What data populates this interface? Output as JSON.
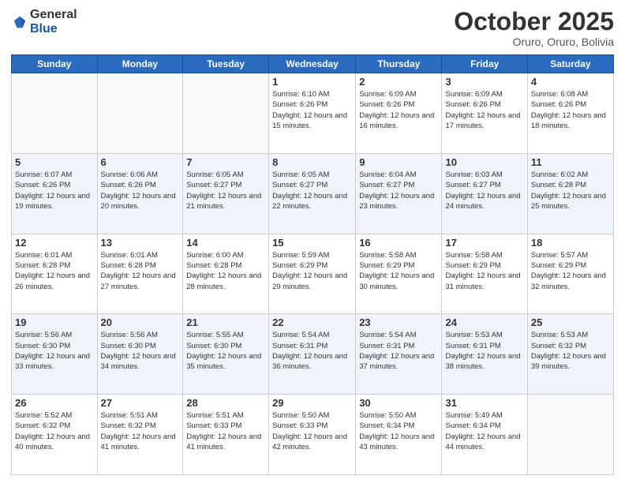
{
  "logo": {
    "general": "General",
    "blue": "Blue"
  },
  "header": {
    "month": "October 2025",
    "location": "Oruro, Oruro, Bolivia"
  },
  "weekdays": [
    "Sunday",
    "Monday",
    "Tuesday",
    "Wednesday",
    "Thursday",
    "Friday",
    "Saturday"
  ],
  "weeks": [
    [
      {
        "day": "",
        "sunrise": "",
        "sunset": "",
        "daylight": ""
      },
      {
        "day": "",
        "sunrise": "",
        "sunset": "",
        "daylight": ""
      },
      {
        "day": "",
        "sunrise": "",
        "sunset": "",
        "daylight": ""
      },
      {
        "day": "1",
        "sunrise": "Sunrise: 6:10 AM",
        "sunset": "Sunset: 6:26 PM",
        "daylight": "Daylight: 12 hours and 15 minutes."
      },
      {
        "day": "2",
        "sunrise": "Sunrise: 6:09 AM",
        "sunset": "Sunset: 6:26 PM",
        "daylight": "Daylight: 12 hours and 16 minutes."
      },
      {
        "day": "3",
        "sunrise": "Sunrise: 6:09 AM",
        "sunset": "Sunset: 6:26 PM",
        "daylight": "Daylight: 12 hours and 17 minutes."
      },
      {
        "day": "4",
        "sunrise": "Sunrise: 6:08 AM",
        "sunset": "Sunset: 6:26 PM",
        "daylight": "Daylight: 12 hours and 18 minutes."
      }
    ],
    [
      {
        "day": "5",
        "sunrise": "Sunrise: 6:07 AM",
        "sunset": "Sunset: 6:26 PM",
        "daylight": "Daylight: 12 hours and 19 minutes."
      },
      {
        "day": "6",
        "sunrise": "Sunrise: 6:06 AM",
        "sunset": "Sunset: 6:26 PM",
        "daylight": "Daylight: 12 hours and 20 minutes."
      },
      {
        "day": "7",
        "sunrise": "Sunrise: 6:05 AM",
        "sunset": "Sunset: 6:27 PM",
        "daylight": "Daylight: 12 hours and 21 minutes."
      },
      {
        "day": "8",
        "sunrise": "Sunrise: 6:05 AM",
        "sunset": "Sunset: 6:27 PM",
        "daylight": "Daylight: 12 hours and 22 minutes."
      },
      {
        "day": "9",
        "sunrise": "Sunrise: 6:04 AM",
        "sunset": "Sunset: 6:27 PM",
        "daylight": "Daylight: 12 hours and 23 minutes."
      },
      {
        "day": "10",
        "sunrise": "Sunrise: 6:03 AM",
        "sunset": "Sunset: 6:27 PM",
        "daylight": "Daylight: 12 hours and 24 minutes."
      },
      {
        "day": "11",
        "sunrise": "Sunrise: 6:02 AM",
        "sunset": "Sunset: 6:28 PM",
        "daylight": "Daylight: 12 hours and 25 minutes."
      }
    ],
    [
      {
        "day": "12",
        "sunrise": "Sunrise: 6:01 AM",
        "sunset": "Sunset: 6:28 PM",
        "daylight": "Daylight: 12 hours and 26 minutes."
      },
      {
        "day": "13",
        "sunrise": "Sunrise: 6:01 AM",
        "sunset": "Sunset: 6:28 PM",
        "daylight": "Daylight: 12 hours and 27 minutes."
      },
      {
        "day": "14",
        "sunrise": "Sunrise: 6:00 AM",
        "sunset": "Sunset: 6:28 PM",
        "daylight": "Daylight: 12 hours and 28 minutes."
      },
      {
        "day": "15",
        "sunrise": "Sunrise: 5:59 AM",
        "sunset": "Sunset: 6:29 PM",
        "daylight": "Daylight: 12 hours and 29 minutes."
      },
      {
        "day": "16",
        "sunrise": "Sunrise: 5:58 AM",
        "sunset": "Sunset: 6:29 PM",
        "daylight": "Daylight: 12 hours and 30 minutes."
      },
      {
        "day": "17",
        "sunrise": "Sunrise: 5:58 AM",
        "sunset": "Sunset: 6:29 PM",
        "daylight": "Daylight: 12 hours and 31 minutes."
      },
      {
        "day": "18",
        "sunrise": "Sunrise: 5:57 AM",
        "sunset": "Sunset: 6:29 PM",
        "daylight": "Daylight: 12 hours and 32 minutes."
      }
    ],
    [
      {
        "day": "19",
        "sunrise": "Sunrise: 5:56 AM",
        "sunset": "Sunset: 6:30 PM",
        "daylight": "Daylight: 12 hours and 33 minutes."
      },
      {
        "day": "20",
        "sunrise": "Sunrise: 5:56 AM",
        "sunset": "Sunset: 6:30 PM",
        "daylight": "Daylight: 12 hours and 34 minutes."
      },
      {
        "day": "21",
        "sunrise": "Sunrise: 5:55 AM",
        "sunset": "Sunset: 6:30 PM",
        "daylight": "Daylight: 12 hours and 35 minutes."
      },
      {
        "day": "22",
        "sunrise": "Sunrise: 5:54 AM",
        "sunset": "Sunset: 6:31 PM",
        "daylight": "Daylight: 12 hours and 36 minutes."
      },
      {
        "day": "23",
        "sunrise": "Sunrise: 5:54 AM",
        "sunset": "Sunset: 6:31 PM",
        "daylight": "Daylight: 12 hours and 37 minutes."
      },
      {
        "day": "24",
        "sunrise": "Sunrise: 5:53 AM",
        "sunset": "Sunset: 6:31 PM",
        "daylight": "Daylight: 12 hours and 38 minutes."
      },
      {
        "day": "25",
        "sunrise": "Sunrise: 5:53 AM",
        "sunset": "Sunset: 6:32 PM",
        "daylight": "Daylight: 12 hours and 39 minutes."
      }
    ],
    [
      {
        "day": "26",
        "sunrise": "Sunrise: 5:52 AM",
        "sunset": "Sunset: 6:32 PM",
        "daylight": "Daylight: 12 hours and 40 minutes."
      },
      {
        "day": "27",
        "sunrise": "Sunrise: 5:51 AM",
        "sunset": "Sunset: 6:32 PM",
        "daylight": "Daylight: 12 hours and 41 minutes."
      },
      {
        "day": "28",
        "sunrise": "Sunrise: 5:51 AM",
        "sunset": "Sunset: 6:33 PM",
        "daylight": "Daylight: 12 hours and 41 minutes."
      },
      {
        "day": "29",
        "sunrise": "Sunrise: 5:50 AM",
        "sunset": "Sunset: 6:33 PM",
        "daylight": "Daylight: 12 hours and 42 minutes."
      },
      {
        "day": "30",
        "sunrise": "Sunrise: 5:50 AM",
        "sunset": "Sunset: 6:34 PM",
        "daylight": "Daylight: 12 hours and 43 minutes."
      },
      {
        "day": "31",
        "sunrise": "Sunrise: 5:49 AM",
        "sunset": "Sunset: 6:34 PM",
        "daylight": "Daylight: 12 hours and 44 minutes."
      },
      {
        "day": "",
        "sunrise": "",
        "sunset": "",
        "daylight": ""
      }
    ]
  ]
}
